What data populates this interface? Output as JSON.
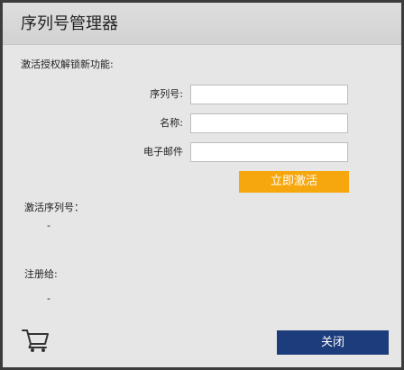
{
  "window": {
    "title": "序列号管理器"
  },
  "intro": "激活授权解锁新功能:",
  "form": {
    "serial_label": "序列号:",
    "serial_value": "",
    "name_label": "名称:",
    "name_value": "",
    "email_label": "电子邮件",
    "email_value": ""
  },
  "activate_label": "立即激活",
  "activated_serial": {
    "label": "激活序列号：",
    "value": "-"
  },
  "registered_to": {
    "label": "注册给:",
    "value": "-"
  },
  "icons": {
    "cart": "shopping-cart-icon"
  },
  "close_label": "关闭",
  "colors": {
    "accent_orange": "#f7a70e",
    "close_blue": "#1d3c7b",
    "window_bg": "#e6e6e6",
    "titlebar_bg": "#d6d6d6"
  }
}
